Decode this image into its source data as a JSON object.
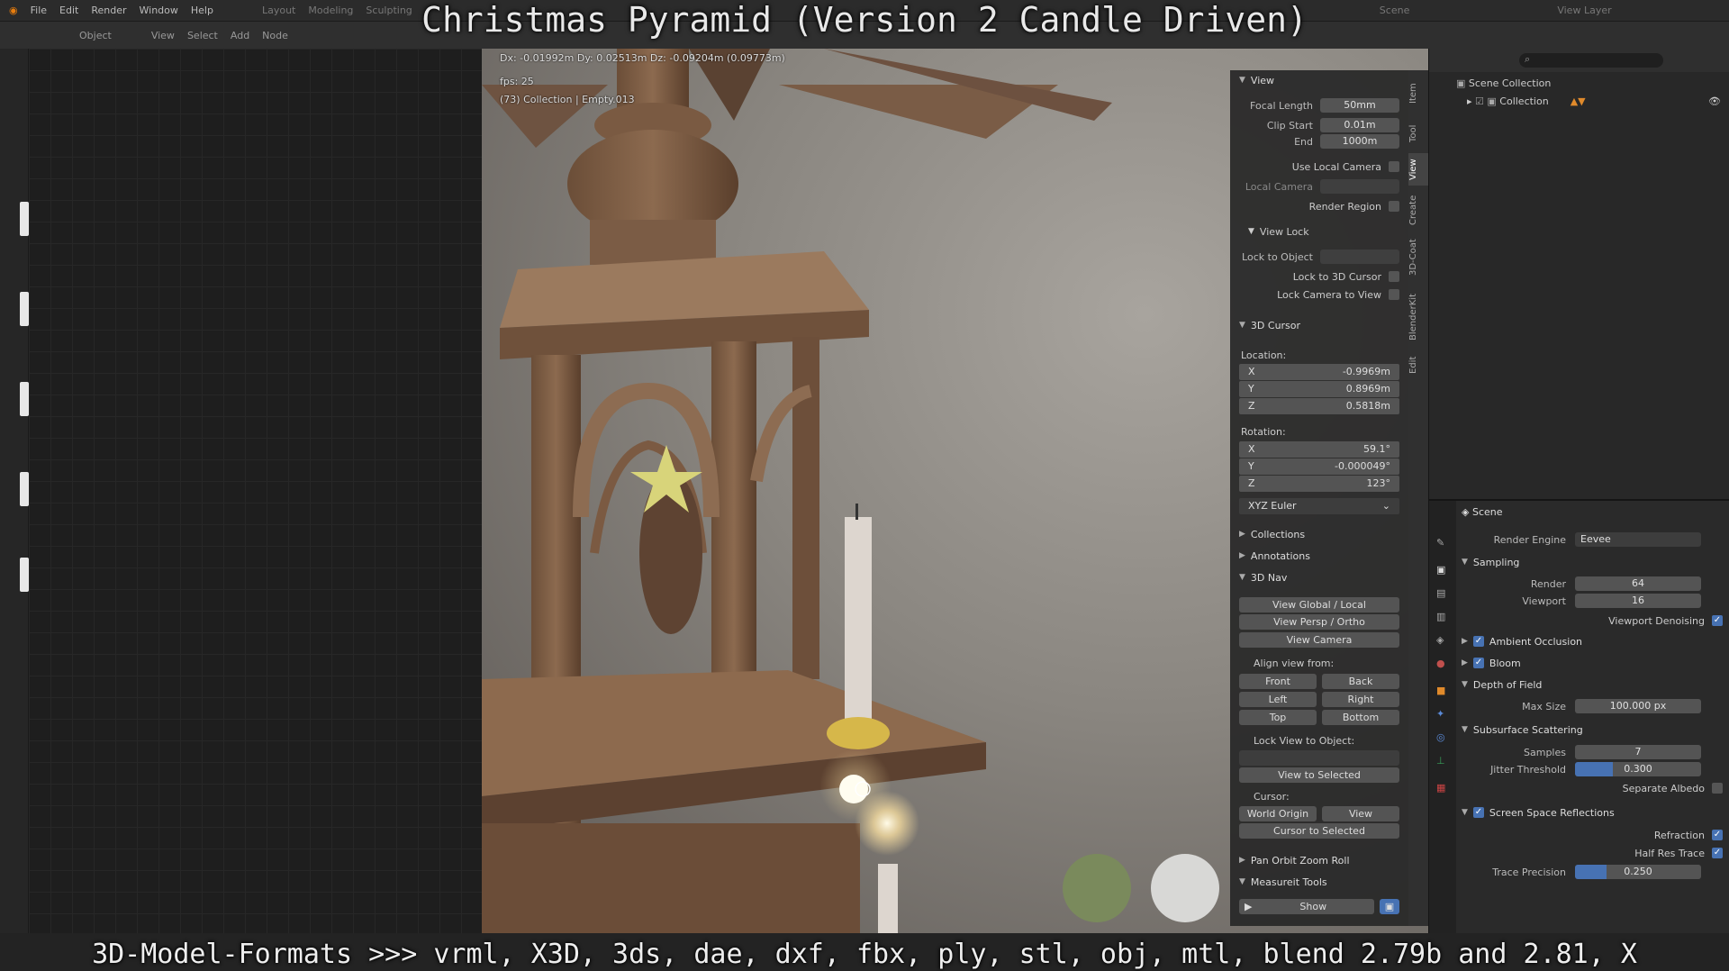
{
  "menu": {
    "items": [
      "File",
      "Edit",
      "Render",
      "Window",
      "Help"
    ],
    "workspaces": [
      "Layout",
      "Modeling",
      "Sculpting"
    ],
    "scene": "Scene",
    "view_layer": "View Layer"
  },
  "header2": {
    "mode": "Object",
    "items": [
      "View",
      "Select",
      "Add",
      "Node"
    ]
  },
  "overlay": {
    "title": "Christmas Pyramid (Version 2 Candle Driven)",
    "caption": "3D-Model-Formats >>> vrml, X3D, 3ds, dae, dxf, fbx, ply, stl, obj, mtl, blend 2.79b and 2.81, X"
  },
  "viewport": {
    "measure": "Dx: -0.01992m  Dy: 0.02513m  Dz: -0.09204m (0.09773m)",
    "fps": "fps: 25",
    "object_info": "(73) Collection | Empty.013"
  },
  "npanel": {
    "view_header": "View",
    "focal_label": "Focal Length",
    "focal_value": "50mm",
    "clip_start_label": "Clip Start",
    "clip_start_value": "0.01m",
    "end_label": "End",
    "end_value": "1000m",
    "use_local_camera": "Use Local Camera",
    "local_camera": "Local Camera",
    "render_region": "Render Region",
    "view_lock": "View Lock",
    "lock_to_object": "Lock to Object",
    "lock_to_cursor": "Lock to 3D Cursor",
    "lock_camera": "Lock Camera to View",
    "cursor_header": "3D Cursor",
    "location": "Location:",
    "loc_x": "-0.9969m",
    "loc_y": "0.8969m",
    "loc_z": "0.5818m",
    "rotation": "Rotation:",
    "rot_x": "59.1°",
    "rot_y": "-0.000049°",
    "rot_z": "123°",
    "rot_mode": "XYZ Euler",
    "collections": "Collections",
    "annotations": "Annotations",
    "nav": "3D Nav",
    "view_global": "View Global / Local",
    "view_persp": "View Persp / Ortho",
    "view_camera": "View Camera",
    "align_from": "Align view from:",
    "front": "Front",
    "back": "Back",
    "left": "Left",
    "right": "Right",
    "top": "Top",
    "bottom": "Bottom",
    "lock_view_obj": "Lock View to Object:",
    "view_selected": "View to Selected",
    "cursor": "Cursor:",
    "world_origin": "World Origin",
    "view": "View",
    "cursor_to_selected": "Cursor to Selected",
    "pan_orbit": "Pan Orbit Zoom Roll",
    "measure_tools": "Measureit Tools",
    "show": "Show",
    "tabs": [
      "Item",
      "Tool",
      "View",
      "Create",
      "3D-Coat",
      "BlenderKit",
      "Edit"
    ]
  },
  "outliner": {
    "scene_collection": "Scene Collection",
    "collection": "Collection"
  },
  "properties": {
    "scene": "Scene",
    "render_engine_label": "Render Engine",
    "render_engine": "Eevee",
    "sampling": "Sampling",
    "render_label": "Render",
    "render_value": "64",
    "viewport_label": "Viewport",
    "viewport_value": "16",
    "viewport_denoising": "Viewport Denoising",
    "ao": "Ambient Occlusion",
    "bloom": "Bloom",
    "dof": "Depth of Field",
    "max_size_label": "Max Size",
    "max_size_value": "100.000 px",
    "sss": "Subsurface Scattering",
    "samples_label": "Samples",
    "samples_value": "7",
    "jitter_label": "Jitter Threshold",
    "jitter_value": "0.300",
    "separate_albedo": "Separate Albedo",
    "ssr": "Screen Space Reflections",
    "refraction": "Refraction",
    "half_res": "Half Res Trace",
    "trace_label": "Trace Precision",
    "trace_value": "0.250"
  }
}
